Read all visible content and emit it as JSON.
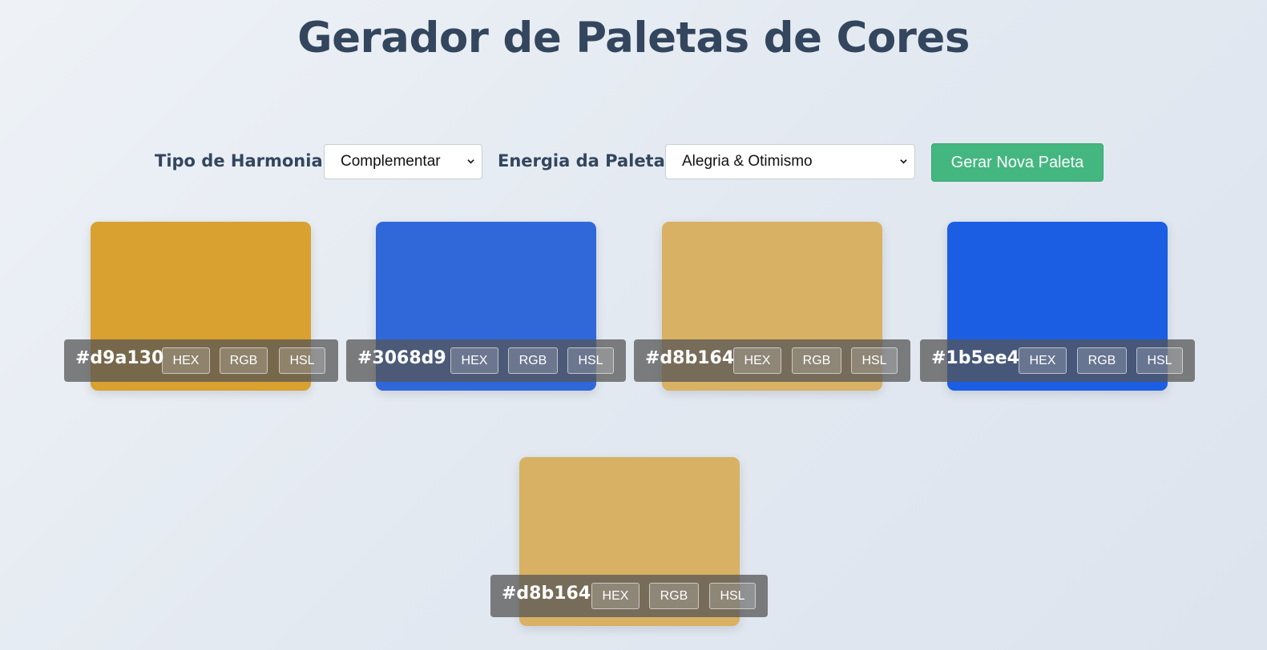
{
  "page": {
    "title": "Gerador de Paletas de Cores"
  },
  "controls": {
    "harmony_label": "Tipo de Harmonia:",
    "harmony_selected": "Complementar",
    "energy_label": "Energia da Paleta:",
    "energy_selected": "Alegria & Otimismo",
    "generate_label": "Gerar Nova Paleta",
    "generate_color": "#43b77f"
  },
  "palette": [
    {
      "hex": "#d9a130",
      "color": "#d9a130",
      "formats": [
        "HEX",
        "RGB",
        "HSL"
      ]
    },
    {
      "hex": "#3068d9",
      "color": "#3068d9",
      "formats": [
        "HEX",
        "RGB",
        "HSL"
      ]
    },
    {
      "hex": "#d8b164",
      "color": "#d8b164",
      "formats": [
        "HEX",
        "RGB",
        "HSL"
      ]
    },
    {
      "hex": "#1b5ee4",
      "color": "#1b5ee4",
      "formats": [
        "HEX",
        "RGB",
        "HSL"
      ]
    },
    {
      "hex": "#d8b164",
      "color": "#d8b164",
      "formats": [
        "HEX",
        "RGB",
        "HSL"
      ]
    }
  ],
  "icons": {
    "select_arrow": "chevron-down-icon"
  },
  "colors": {
    "title": "#33465e",
    "background": "#e3e9f1"
  }
}
